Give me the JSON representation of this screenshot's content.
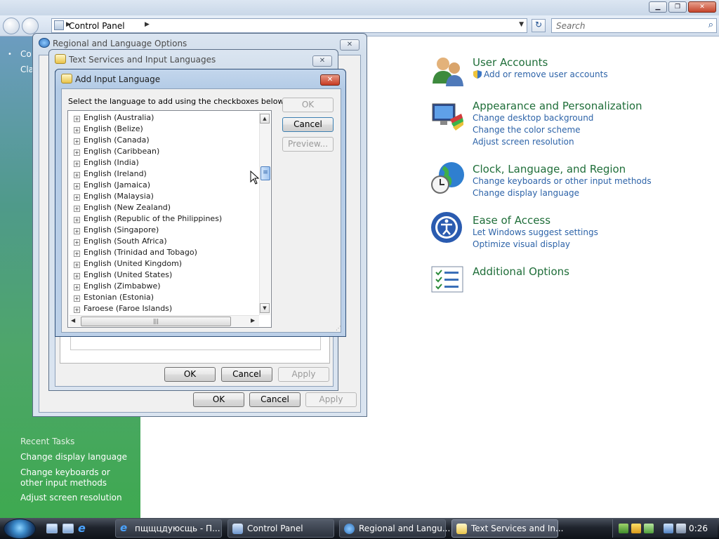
{
  "window": {
    "buttons": [
      "▁",
      "❐",
      "✕"
    ],
    "address": "Control Panel",
    "search_placeholder": "Search"
  },
  "left_pane": {
    "links": [
      "Co",
      "Cla"
    ],
    "recent_title": "Recent Tasks",
    "recent_tasks": [
      "Change display language",
      "Change keyboards or other input methods",
      "Adjust screen resolution"
    ]
  },
  "categories": [
    {
      "title": "User Accounts",
      "links": [
        "Add or remove user accounts"
      ]
    },
    {
      "title": "Appearance and Personalization",
      "links": [
        "Change desktop background",
        "Change the color scheme",
        "Adjust screen resolution"
      ]
    },
    {
      "title": "Clock, Language, and Region",
      "links": [
        "Change keyboards or other input methods",
        "Change display language"
      ]
    },
    {
      "title": "Ease of Access",
      "links": [
        "Let Windows suggest settings",
        "Optimize visual display"
      ]
    },
    {
      "title": "Additional Options",
      "links": []
    }
  ],
  "dialog_regional": {
    "title": "Regional and Language Options",
    "ok": "OK",
    "cancel": "Cancel",
    "apply": "Apply"
  },
  "dialog_text_services": {
    "title": "Text Services and Input Languages",
    "ok": "OK",
    "cancel": "Cancel",
    "apply": "Apply"
  },
  "dialog_add_language": {
    "title": "Add Input Language",
    "instruction": "Select the language to add using the checkboxes below.",
    "ok": "OK",
    "cancel": "Cancel",
    "preview": "Preview...",
    "languages": [
      "English (Australia)",
      "English (Belize)",
      "English (Canada)",
      "English (Caribbean)",
      "English (India)",
      "English (Ireland)",
      "English (Jamaica)",
      "English (Malaysia)",
      "English (New Zealand)",
      "English (Republic of the Philippines)",
      "English (Singapore)",
      "English (South Africa)",
      "English (Trinidad and Tobago)",
      "English (United Kingdom)",
      "English (United States)",
      "English (Zimbabwe)",
      "Estonian (Estonia)",
      "Faroese (Faroe Islands)"
    ]
  },
  "taskbar": {
    "tasks": [
      {
        "label": "пщщцдуюсщь - П...",
        "active": false
      },
      {
        "label": "Control Panel",
        "active": false
      },
      {
        "label": "Regional and Langu...",
        "active": false
      },
      {
        "label": "Text Services and In...",
        "active": true
      }
    ],
    "clock": "0:26"
  }
}
